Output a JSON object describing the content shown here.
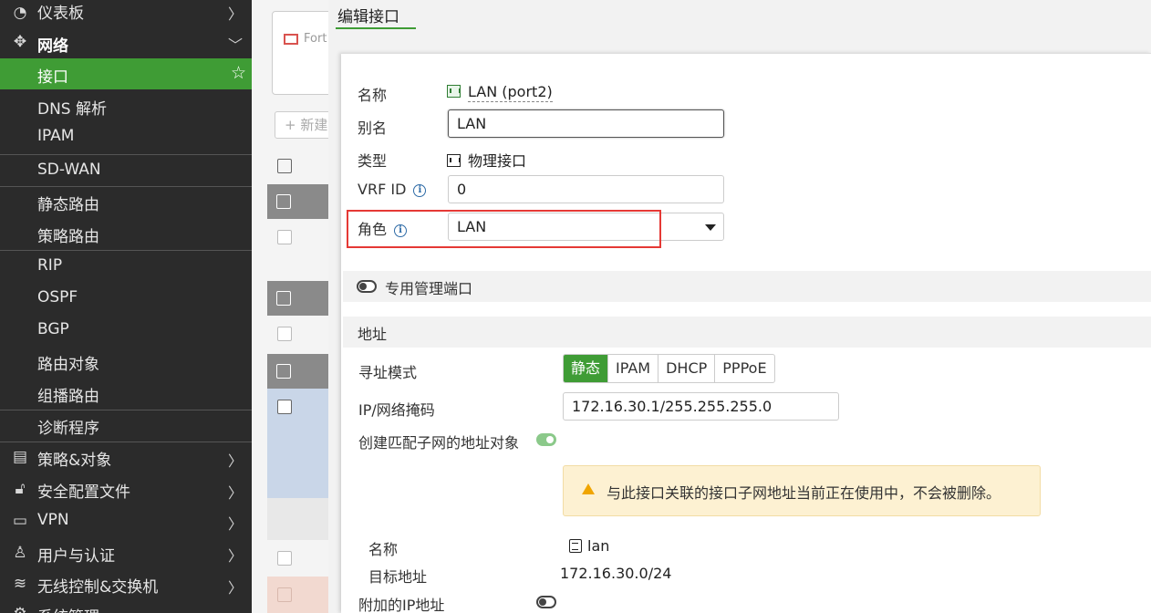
{
  "sidebar": {
    "items": [
      {
        "label": "仪表板",
        "icon": "dashboard-gauge-icon"
      },
      {
        "label": "网络",
        "icon": "network-move-icon"
      },
      {
        "label": "接口"
      },
      {
        "label": "DNS 解析"
      },
      {
        "label": "IPAM"
      },
      {
        "label": "SD-WAN"
      },
      {
        "label": "静态路由"
      },
      {
        "label": "策略路由"
      },
      {
        "label": "RIP"
      },
      {
        "label": "OSPF"
      },
      {
        "label": "BGP"
      },
      {
        "label": "路由对象"
      },
      {
        "label": "组播路由"
      },
      {
        "label": "诊断程序"
      },
      {
        "label": "策略&对象",
        "icon": "policy-document-icon"
      },
      {
        "label": "安全配置文件",
        "icon": "lock-icon"
      },
      {
        "label": "VPN",
        "icon": "laptop-icon"
      },
      {
        "label": "用户与认证",
        "icon": "user-icon"
      },
      {
        "label": "无线控制&交换机",
        "icon": "wifi-icon"
      },
      {
        "label": "系统管理",
        "icon": "gear-icon"
      }
    ]
  },
  "background": {
    "card_text": "Fort",
    "new_button": "+ 新建"
  },
  "panel": {
    "title": "编辑接口",
    "name_label": "名称",
    "name_value": "LAN (port2)",
    "alias_label": "别名",
    "alias_value": "LAN",
    "type_label": "类型",
    "type_value": "物理接口",
    "vrf_label": "VRF ID",
    "vrf_value": "0",
    "role_label": "角色",
    "role_value": "LAN",
    "dedicated_mgmt_label": "专用管理端口",
    "address_section": "地址",
    "addr_mode_label": "寻址模式",
    "addr_modes": [
      "静态",
      "IPAM",
      "DHCP",
      "PPPoE"
    ],
    "addr_mode_selected": "静态",
    "ip_label": "IP/网络掩码",
    "ip_value": "172.16.30.1/255.255.255.0",
    "create_addr_obj_label": "创建匹配子网的地址对象",
    "create_addr_obj_enabled": true,
    "warning_text": "与此接口关联的接口子网地址当前正在使用中，不会被删除。",
    "obj_name_label": "名称",
    "obj_name_value": "lan",
    "obj_dest_label": "目标地址",
    "obj_dest_value": "172.16.30.0/24",
    "secondary_ip_label": "附加的IP地址",
    "secondary_ip_enabled": false
  },
  "colors": {
    "accent_green": "#3f9c35",
    "sidebar_bg": "#2b2b2b",
    "highlight_red": "#e53935",
    "warning_bg": "#fdf1d2"
  }
}
